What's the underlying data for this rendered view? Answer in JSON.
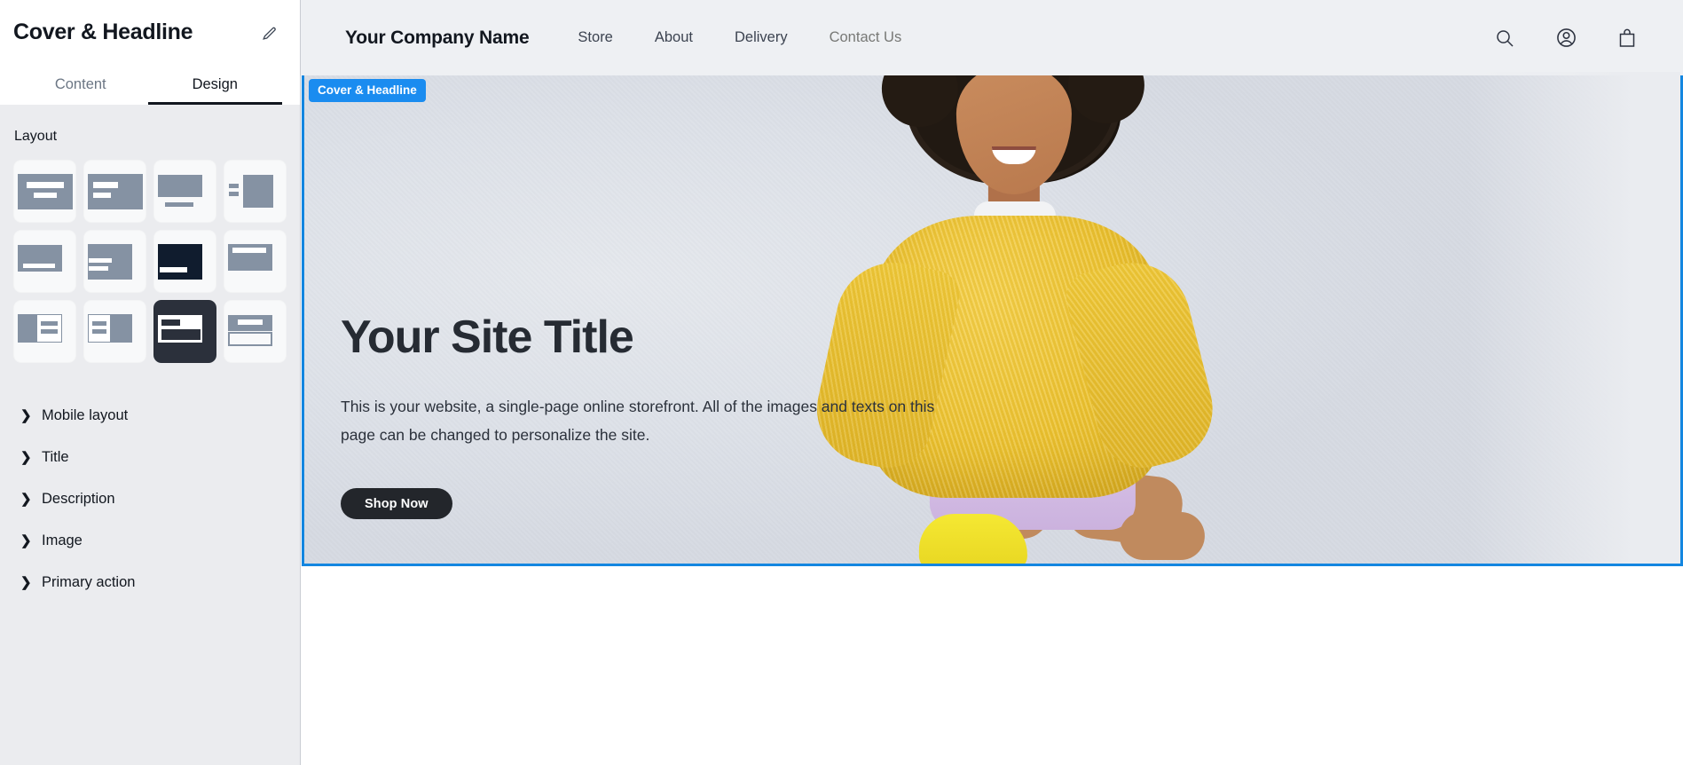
{
  "sidebar": {
    "title": "Cover & Headline",
    "edit_icon": "pencil-icon",
    "tabs": [
      {
        "label": "Content",
        "active": false
      },
      {
        "label": "Design",
        "active": true
      }
    ],
    "layout_label": "Layout",
    "layout_thumbnails": [
      {
        "id": 1,
        "name": "centered-top",
        "selected": false
      },
      {
        "id": 2,
        "name": "left-top",
        "selected": false
      },
      {
        "id": 3,
        "name": "image-above-caption",
        "selected": false
      },
      {
        "id": 4,
        "name": "text-left-image-right",
        "selected": false
      },
      {
        "id": 5,
        "name": "image-above-bar",
        "selected": false
      },
      {
        "id": 6,
        "name": "left-middle-lines",
        "selected": false
      },
      {
        "id": 7,
        "name": "dark-bottom-bar",
        "selected": false
      },
      {
        "id": 8,
        "name": "top-bar-light",
        "selected": false
      },
      {
        "id": 9,
        "name": "split-right-panel",
        "selected": false
      },
      {
        "id": 10,
        "name": "split-left-panel",
        "selected": false
      },
      {
        "id": 11,
        "name": "overlay-card-dark",
        "selected": true
      },
      {
        "id": 12,
        "name": "stacked-outline",
        "selected": false
      }
    ],
    "sections": [
      {
        "label": "Mobile layout",
        "expanded": false
      },
      {
        "label": "Title",
        "expanded": false
      },
      {
        "label": "Description",
        "expanded": false
      },
      {
        "label": "Image",
        "expanded": false
      },
      {
        "label": "Primary action",
        "expanded": false
      }
    ]
  },
  "preview": {
    "selection_badge": "Cover & Headline",
    "accent_color": "#1A8CF0",
    "nav": {
      "brand": "Your Company Name",
      "links": [
        "Store",
        "About",
        "Delivery",
        "Contact Us"
      ],
      "icons": [
        "search-icon",
        "account-icon",
        "cart-icon"
      ]
    },
    "hero": {
      "title": "Your Site Title",
      "description": "This is your website, a single-page online storefront. All of the images and texts on this page can be changed to personalize the site.",
      "cta_label": "Shop Now",
      "cta_color": "#23262B"
    }
  }
}
